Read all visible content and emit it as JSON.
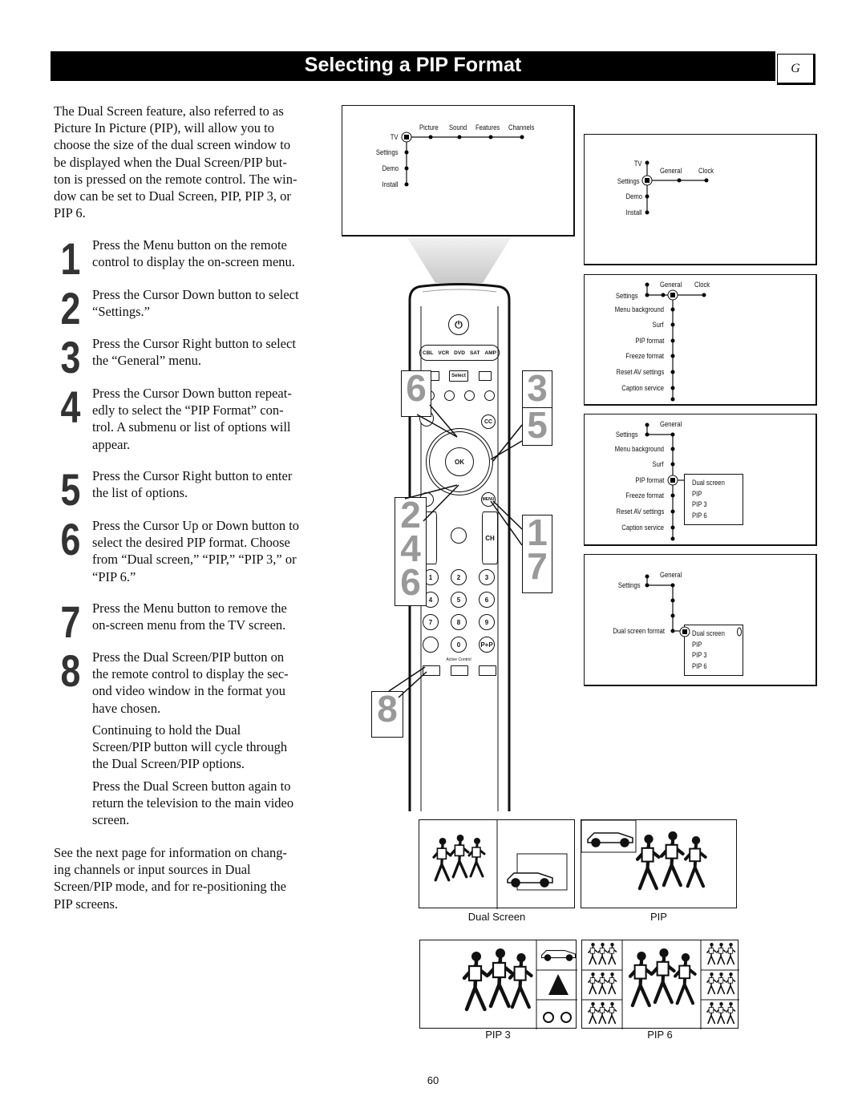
{
  "header": {
    "title": "Selecting a PIP Format",
    "section_tab": "G"
  },
  "intro": [
    "The Dual Screen feature, also referred to as",
    "Picture In Picture (PIP), will allow you to",
    "choose the size of the dual screen window to",
    "be displayed when the Dual Screen/PIP but-",
    "ton is pressed on the remote control. The win-",
    "dow can be set to Dual Screen, PIP, PIP 3, or",
    "PIP 6."
  ],
  "steps": [
    {
      "num": "1",
      "lines": [
        "Press the Menu button on the remote",
        "control to display the on-screen menu."
      ]
    },
    {
      "num": "2",
      "lines": [
        "Press the Cursor Down button to select",
        "“Settings.”"
      ]
    },
    {
      "num": "3",
      "lines": [
        "Press the Cursor Right button to select",
        "the “General” menu."
      ]
    },
    {
      "num": "4",
      "lines": [
        "Press the Cursor Down button repeat-",
        "edly to select the “PIP Format” con-",
        "trol. A submenu or list of options will",
        "appear."
      ]
    },
    {
      "num": "5",
      "lines": [
        "Press the Cursor Right button to enter",
        "the list of options."
      ]
    },
    {
      "num": "6",
      "lines": [
        "Press the Cursor Up or Down button to",
        "select the desired PIP format. Choose",
        "from “Dual screen,” “PIP,” “PIP 3,” or",
        "“PIP 6.”"
      ]
    },
    {
      "num": "7",
      "lines": [
        "Press the Menu button to remove the",
        "on-screen menu from the TV screen."
      ]
    },
    {
      "num": "8",
      "lines": [
        "Press the Dual Screen/PIP button on",
        "the remote control to display the sec-",
        "ond video window in the format you",
        "have chosen."
      ]
    }
  ],
  "continue1": [
    "Continuing to hold the Dual",
    "Screen/PIP button will cycle through",
    "the Dual Screen/PIP options."
  ],
  "continue2": [
    "Press the Dual Screen button again to",
    "return the television to the main video",
    "screen."
  ],
  "footer_note": [
    "See the next page for information on chang-",
    "ing channels or input sources in Dual",
    "Screen/PIP mode, and for re-positioning the",
    "PIP screens."
  ],
  "menu1": {
    "root": "TV",
    "top": [
      "Picture",
      "Sound",
      "Features",
      "Channels"
    ],
    "side": [
      "Settings",
      "Demo",
      "Install"
    ]
  },
  "menu2": {
    "side": [
      "TV",
      "Settings",
      "Demo",
      "Install"
    ],
    "top": [
      "General",
      "Clock"
    ]
  },
  "menu3": {
    "root": "Settings",
    "top": [
      "General",
      "Clock"
    ],
    "items": [
      "Menu background",
      "Surf",
      "PIP format",
      "Freeze format",
      "Reset AV settings",
      "Caption service"
    ]
  },
  "menu4": {
    "root": "Settings",
    "top": "General",
    "items": [
      "Menu background",
      "Surf",
      "PIP format",
      "Freeze format",
      "Reset AV settings",
      "Caption service"
    ],
    "options": [
      "Dual screen",
      "PIP",
      "PIP 3",
      "PIP 6"
    ]
  },
  "menu5": {
    "root": "Settings",
    "top": "General",
    "item": "Dual screen format",
    "options": [
      "Dual screen",
      "PIP",
      "PIP 3",
      "PIP 6"
    ]
  },
  "remote": {
    "sources": [
      "CBL",
      "VCR",
      "DVD",
      "SAT",
      "AMP"
    ],
    "select": "Select",
    "cc": "CC",
    "ok": "OK",
    "menu": "MENU",
    "ch": "CH",
    "keys": [
      "1",
      "2",
      "3",
      "4",
      "5",
      "6",
      "7",
      "8",
      "9",
      "0",
      "P+P"
    ],
    "active_control": "Active Control"
  },
  "callouts": [
    "6",
    "3",
    "5",
    "2\n4\n6",
    "1\n7",
    "8"
  ],
  "formats": [
    "Dual Screen",
    "PIP",
    "PIP 3",
    "PIP 6"
  ],
  "page_number": "60"
}
